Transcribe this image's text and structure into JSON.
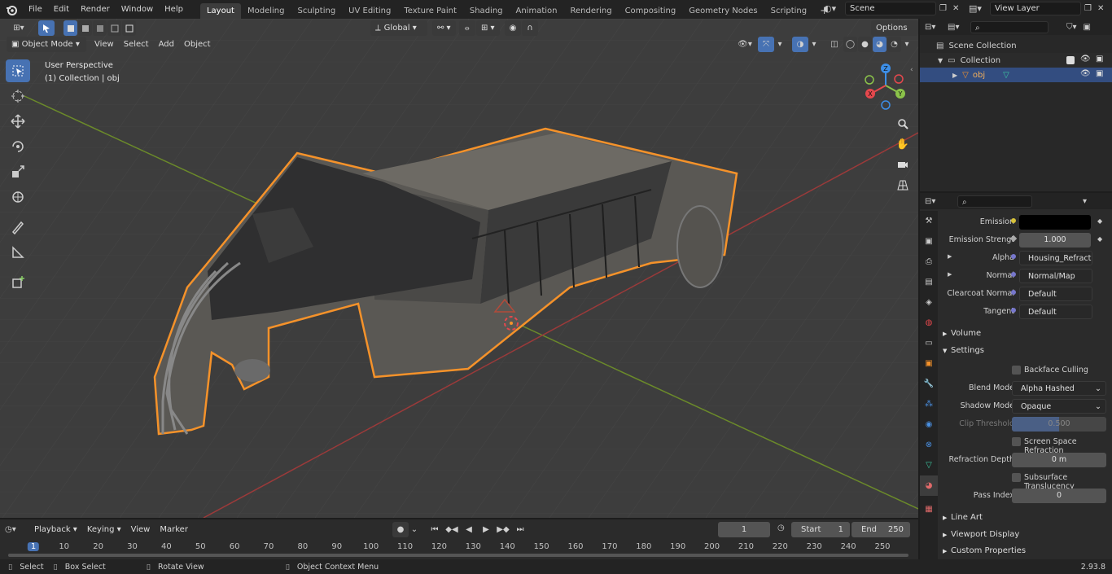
{
  "topbar": {
    "menus": [
      "File",
      "Edit",
      "Render",
      "Window",
      "Help"
    ],
    "workspaces": [
      "Layout",
      "Modeling",
      "Sculpting",
      "UV Editing",
      "Texture Paint",
      "Shading",
      "Animation",
      "Rendering",
      "Compositing",
      "Geometry Nodes",
      "Scripting"
    ],
    "active_workspace": "Layout",
    "scene": "Scene",
    "view_layer": "View Layer"
  },
  "viewport": {
    "mode": "Object Mode",
    "menus": [
      "View",
      "Select",
      "Add",
      "Object"
    ],
    "orientation": "Global",
    "options_label": "Options",
    "info_line1": "User Perspective",
    "info_line2": "(1) Collection | obj",
    "gizmo": {
      "z": "Z",
      "y": "Y",
      "x": "X"
    }
  },
  "outliner": {
    "scene_collection": "Scene Collection",
    "collection": "Collection",
    "object": "obj"
  },
  "properties": {
    "emission_label": "Emission",
    "emission_strength_label": "Emission Strengt",
    "emission_strength_value": "1.000",
    "alpha_label": "Alpha",
    "alpha_value": "Housing_Refraction_...",
    "normal_label": "Normal",
    "normal_value": "Normal/Map",
    "clearcoat_label": "Clearcoat Normal",
    "clearcoat_value": "Default",
    "tangent_label": "Tangent",
    "tangent_value": "Default",
    "volume_panel": "Volume",
    "settings_panel": "Settings",
    "backface_culling": "Backface Culling",
    "blend_mode_label": "Blend Mode",
    "blend_mode_value": "Alpha Hashed",
    "shadow_mode_label": "Shadow Mode",
    "shadow_mode_value": "Opaque",
    "clip_threshold_label": "Clip Threshold",
    "clip_threshold_value": "0.500",
    "screen_space_refraction": "Screen Space Refraction",
    "refraction_depth_label": "Refraction Depth",
    "refraction_depth_value": "0 m",
    "subsurface_translucency": "Subsurface Translucency",
    "pass_index_label": "Pass Index",
    "pass_index_value": "0",
    "line_art_panel": "Line Art",
    "viewport_display_panel": "Viewport Display",
    "custom_properties_panel": "Custom Properties"
  },
  "timeline": {
    "menus": [
      "Playback",
      "Keying",
      "View",
      "Marker"
    ],
    "current_frame": "1",
    "start_label": "Start",
    "start_value": "1",
    "end_label": "End",
    "end_value": "250",
    "ticks": [
      "1",
      "10",
      "20",
      "30",
      "40",
      "50",
      "60",
      "70",
      "80",
      "90",
      "100",
      "110",
      "120",
      "130",
      "140",
      "150",
      "160",
      "170",
      "180",
      "190",
      "200",
      "210",
      "220",
      "230",
      "240",
      "250"
    ]
  },
  "statusbar": {
    "select": "Select",
    "box_select": "Box Select",
    "rotate_view": "Rotate View",
    "context_menu": "Object Context Menu",
    "version": "2.93.8"
  },
  "colors": {
    "accent": "#4772b3",
    "selection_outline": "#f5922a",
    "x_axis": "#e5484d",
    "y_axis": "#8bc34a",
    "z_axis": "#3d8fe8"
  }
}
